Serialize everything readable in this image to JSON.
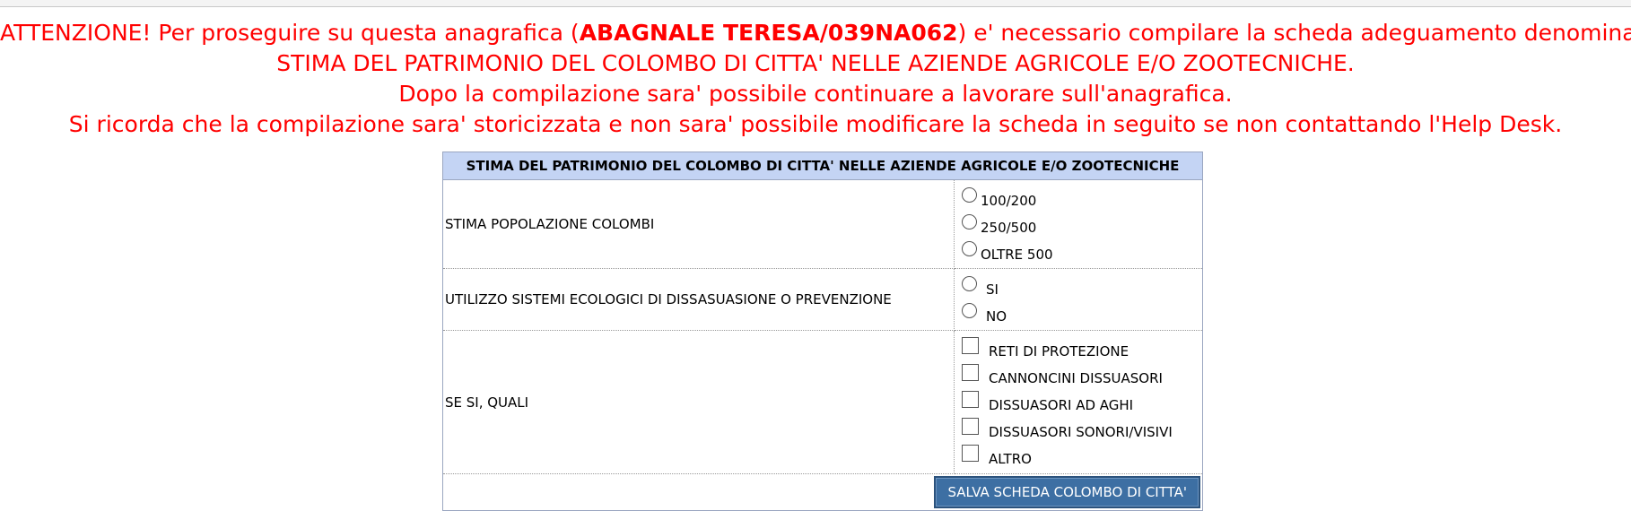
{
  "notice": {
    "line1_prefix": "ATTENZIONE! Per proseguire su questa anagrafica (",
    "line1_name": "ABAGNALE TERESA/039NA062",
    "line1_suffix": ") e' necessario compilare la scheda adeguamento denominata:",
    "line2": "STIMA DEL PATRIMONIO DEL COLOMBO DI CITTA' NELLE AZIENDE AGRICOLE E/O ZOOTECNICHE.",
    "line3": "Dopo la compilazione sara' possibile continuare a lavorare sull'anagrafica.",
    "line4": "Si ricorda che la compilazione sara' storicizzata e non sara' possibile modificare la scheda in seguito se non contattando l'Help Desk."
  },
  "form": {
    "header": "STIMA DEL PATRIMONIO DEL COLOMBO DI CITTA' NELLE AZIENDE AGRICOLE E/O ZOOTECNICHE",
    "q1": {
      "label": "STIMA POPOLAZIONE COLOMBI",
      "options": [
        "100/200",
        "250/500",
        "OLTRE 500"
      ]
    },
    "q2": {
      "label": "UTILIZZO SISTEMI ECOLOGICI DI DISSASUASIONE O PREVENZIONE",
      "options": [
        "SI",
        "NO"
      ]
    },
    "q3": {
      "label": "SE SI, QUALI",
      "options": [
        "RETI DI PROTEZIONE",
        "CANNONCINI DISSUASORI",
        "DISSUASORI AD AGHI",
        "DISSUASORI SONORI/VISIVI",
        "ALTRO"
      ]
    },
    "save_label": "SALVA SCHEDA COLOMBO DI CITTA'"
  }
}
